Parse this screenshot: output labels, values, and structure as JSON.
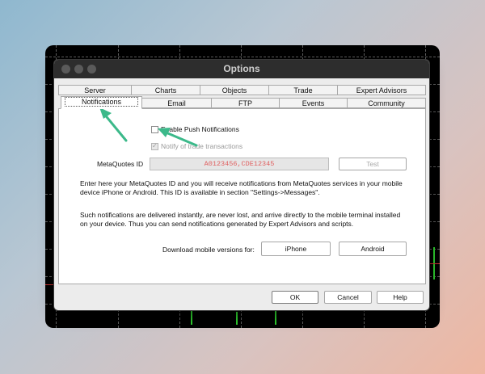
{
  "window": {
    "title": "Options"
  },
  "tabs_row1": [
    "Server",
    "Charts",
    "Objects",
    "Trade",
    "Expert Advisors"
  ],
  "tabs_row2": [
    "Notifications",
    "Email",
    "FTP",
    "Events",
    "Community"
  ],
  "notifications": {
    "enable_push_label": "Enable Push Notifications",
    "enable_push_checked": false,
    "notify_trade_label": "Notify of trade transactions",
    "notify_trade_checked": true,
    "metaquotes_id_label": "MetaQuotes ID",
    "metaquotes_id_value": "A0123456,CDE12345",
    "test_button": "Test",
    "description1": "Enter here your MetaQuotes ID and you will receive notifications from MetaQuotes services in your mobile device iPhone or Android. This ID is available in section \"Settings->Messages\".",
    "description2": "Such notifications are delivered instantly, are never lost, and arrive directly to the mobile terminal installed on your device. Thus you can send notifications generated by Expert Advisors and scripts.",
    "download_label": "Download mobile versions for:",
    "iphone_button": "iPhone",
    "android_button": "Android"
  },
  "buttons": {
    "ok": "OK",
    "cancel": "Cancel",
    "help": "Help"
  },
  "colors": {
    "annotation_arrow": "#3cb98a",
    "id_text": "#e06060"
  }
}
